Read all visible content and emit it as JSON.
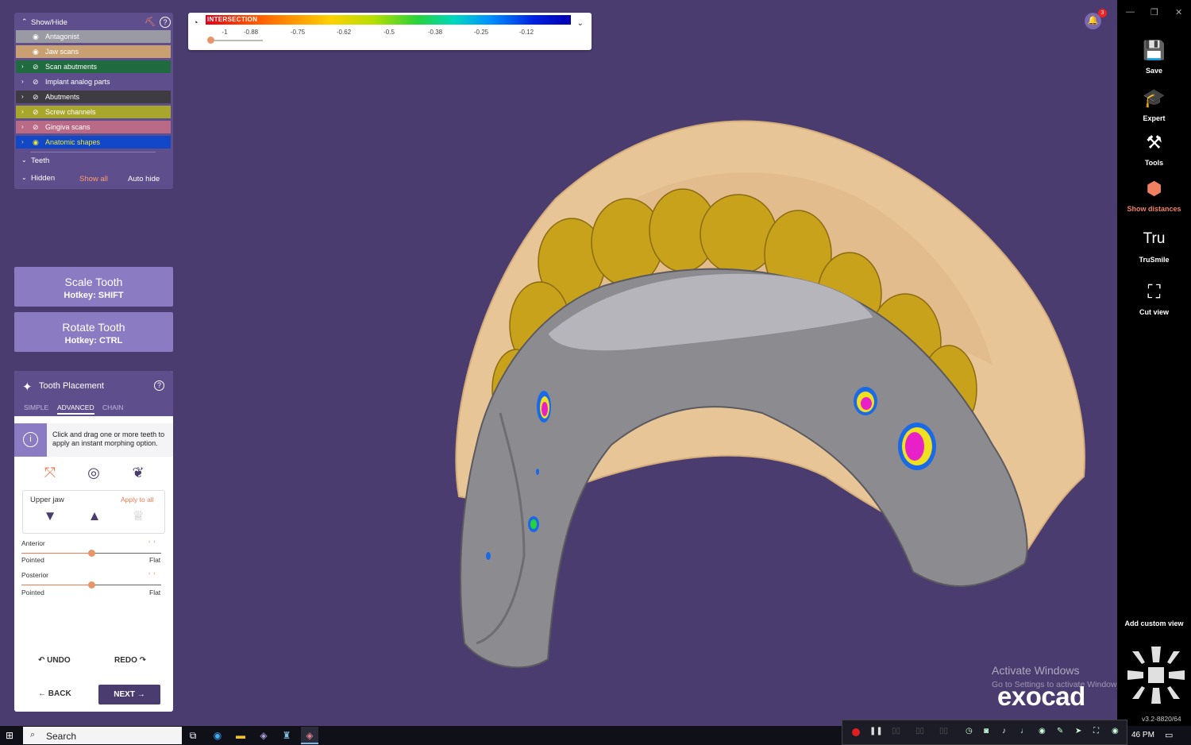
{
  "scale": {
    "title": "INTERSECTION",
    "ticks": [
      "-1",
      "-0.88",
      "-0.75",
      "-0.62",
      "-0.5",
      "-0.38",
      "-0.25",
      "-0.12"
    ],
    "gauge_icon": "gauge-icon",
    "chevron_icon": "chevron-down-icon"
  },
  "notifications": {
    "count": "3"
  },
  "showhide": {
    "title": "Show/Hide",
    "items": [
      {
        "label": "Antagonist",
        "bg": "#9a9aa4",
        "fg": "#ffffff",
        "expand": false,
        "visible": true
      },
      {
        "label": "Jaw scans",
        "bg": "#c9a072",
        "fg": "#ffffff",
        "expand": false,
        "visible": true
      },
      {
        "label": "Scan abutments",
        "bg": "#1f6a3e",
        "fg": "#ffffff",
        "expand": true,
        "visible": false
      },
      {
        "label": "Implant analog parts",
        "bg": "#5f4e8c",
        "fg": "#ffffff",
        "expand": true,
        "visible": false
      },
      {
        "label": "Abutments",
        "bg": "#3e3c42",
        "fg": "#ffffff",
        "expand": true,
        "visible": false
      },
      {
        "label": "Screw channels",
        "bg": "#a9a62c",
        "fg": "#ffffff",
        "expand": true,
        "visible": false
      },
      {
        "label": "Gingiva scans",
        "bg": "#b86a86",
        "fg": "#ffffff",
        "expand": true,
        "visible": false
      },
      {
        "label": "Anatomic shapes",
        "bg": "#1048c8",
        "fg": "#f0e830",
        "expand": true,
        "visible": true
      }
    ],
    "teeth_label": "Teeth",
    "hidden_label": "Hidden",
    "show_all": "Show all",
    "auto_hide": "Auto hide"
  },
  "scale_tooth": {
    "title": "Scale Tooth",
    "hotkey": "Hotkey: SHIFT"
  },
  "rotate_tooth": {
    "title": "Rotate Tooth",
    "hotkey": "Hotkey: CTRL"
  },
  "tooth_placement": {
    "title": "Tooth Placement",
    "tabs": [
      "SIMPLE",
      "ADVANCED",
      "CHAIN"
    ],
    "active_tab": "ADVANCED",
    "info": "Click and drag one or more teeth to apply an instant morphing option.",
    "jaw_label": "Upper jaw",
    "apply_all": "Apply to all",
    "sliders": [
      {
        "label": "Anterior",
        "min_label": "Pointed",
        "max_label": "Flat",
        "value": 0.5
      },
      {
        "label": "Posterior",
        "min_label": "Pointed",
        "max_label": "Flat",
        "value": 0.5
      }
    ],
    "undo": "UNDO",
    "redo": "REDO",
    "back": "BACK",
    "next": "NEXT"
  },
  "toolbar": {
    "tools": [
      {
        "label": "Save",
        "icon": "save-icon"
      },
      {
        "label": "Expert",
        "icon": "graduation-cap-icon"
      },
      {
        "label": "Tools",
        "icon": "tools-icon"
      },
      {
        "label": "Show distances",
        "icon": "show-distances-icon"
      },
      {
        "label": "TruSmile",
        "icon": "trusmile-icon"
      },
      {
        "label": "Cut view",
        "icon": "cut-view-icon"
      }
    ],
    "add_custom_view": "Add custom view",
    "version": "v3.2-8820/64"
  },
  "watermark": {
    "line1": "Activate Windows",
    "line2": "Go to Settings to activate Windows."
  },
  "brand": "exocad",
  "taskbar": {
    "search": "Search",
    "time": "46 PM"
  },
  "colors": {
    "accent": "#ee7a50",
    "panel": "#5f4e8c",
    "viewport": "#4b3c70"
  }
}
